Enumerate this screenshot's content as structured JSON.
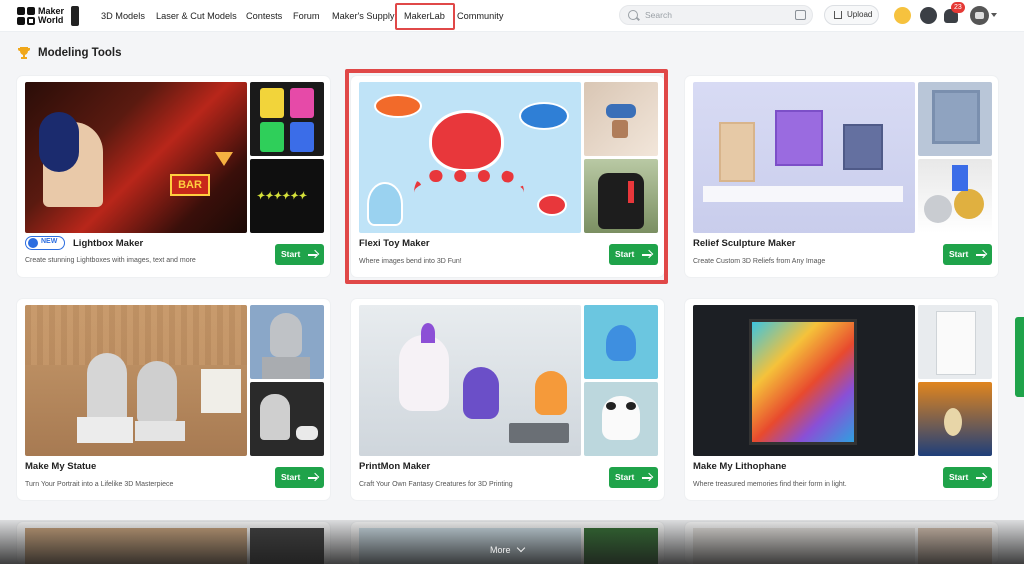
{
  "header": {
    "logo_line1": "Maker",
    "logo_line2": "World",
    "nav": [
      "3D Models",
      "Laser & Cut Models",
      "Contests",
      "Forum",
      "Maker's Supply",
      "MakerLab",
      "Community"
    ],
    "search_placeholder": "Search",
    "upload_label": "Upload",
    "notification_count": "23",
    "icons": [
      "search-icon",
      "image-search-icon",
      "upload-icon",
      "points-icon",
      "message-icon",
      "bell-icon",
      "avatar",
      "chevron-down-icon"
    ]
  },
  "section": {
    "title": "Modeling Tools",
    "icon": "trophy-icon"
  },
  "cards": [
    {
      "title": "Lightbox Maker",
      "desc": "Create stunning Lightboxes with images, text and more",
      "start": "Start",
      "badge": "NEW"
    },
    {
      "title": "Flexi Toy Maker",
      "desc": "Where images bend into 3D Fun!",
      "start": "Start"
    },
    {
      "title": "Relief Sculpture Maker",
      "desc": "Create Custom 3D Reliefs from Any Image",
      "start": "Start"
    },
    {
      "title": "Make My Statue",
      "desc": "Turn Your Portrait into a Lifelike 3D Masterpiece",
      "start": "Start"
    },
    {
      "title": "PrintMon Maker",
      "desc": "Craft Your Own Fantasy Creatures for 3D Printing",
      "start": "Start"
    },
    {
      "title": "Make My Lithophane",
      "desc": "Where treasured memories find their form in light.",
      "start": "Start"
    }
  ],
  "footer": {
    "more_label": "More"
  },
  "colors": {
    "accent_green": "#1fa34a",
    "highlight_red": "#e04848",
    "new_blue": "#2b6de0"
  }
}
